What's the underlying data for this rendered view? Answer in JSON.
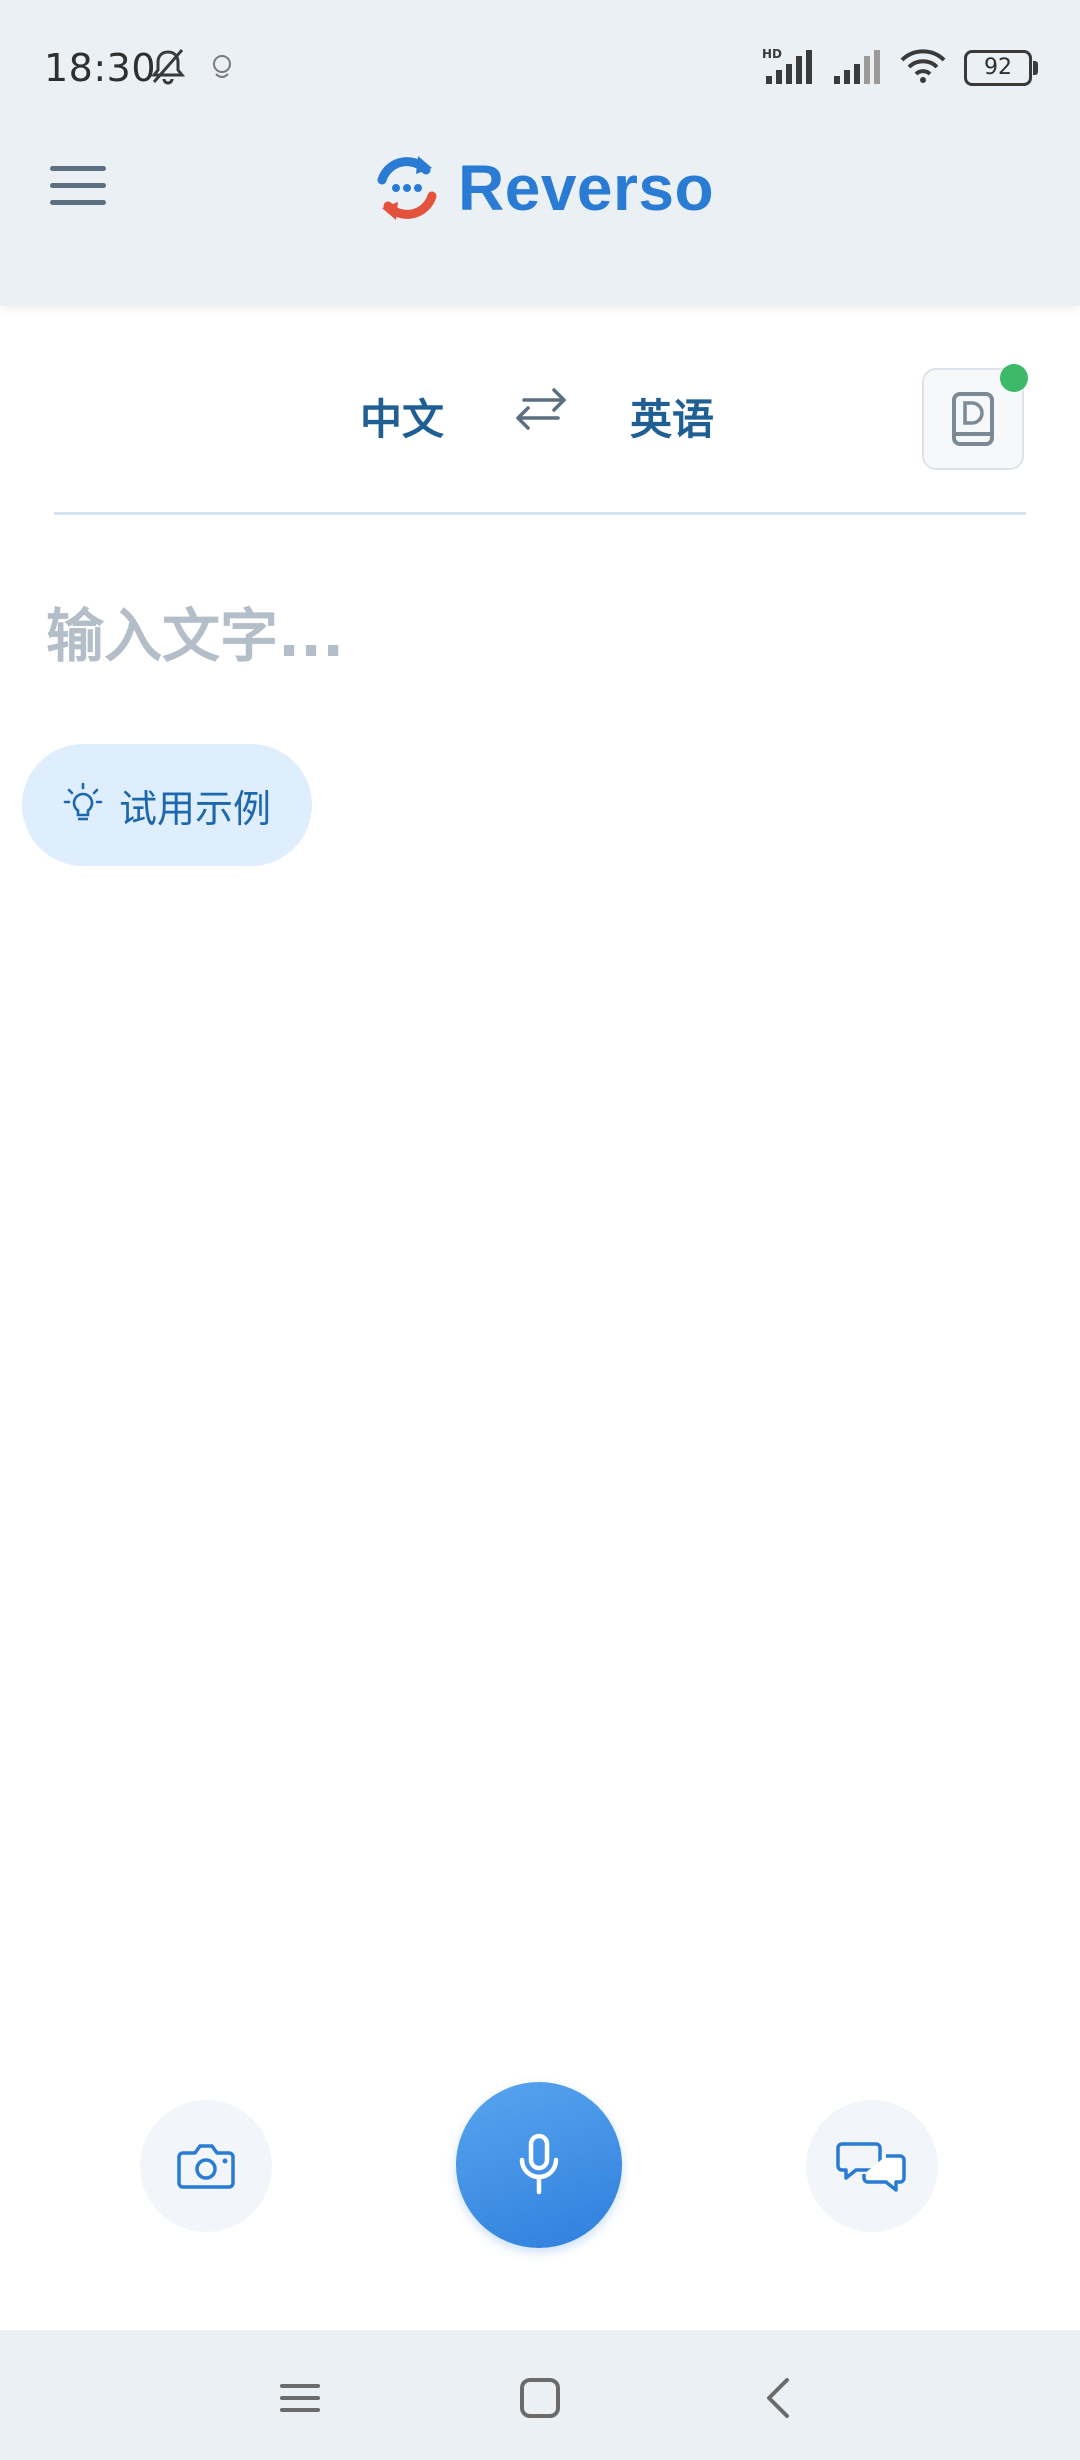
{
  "status_bar": {
    "time": "18:30",
    "battery": "92",
    "network_badge": "HD"
  },
  "header": {
    "app_name": "Reverso",
    "menu_icon": "hamburger-menu-icon"
  },
  "language": {
    "source": "中文",
    "target": "英语",
    "swap_icon": "swap-arrows-icon",
    "dictionary_icon": "dictionary-book-icon",
    "dictionary_badge_color": "#3cba6a"
  },
  "input": {
    "placeholder": "输入文字...",
    "value": ""
  },
  "example_button": {
    "label": "试用示例",
    "icon": "lightbulb-icon"
  },
  "actions": {
    "camera_icon": "camera-icon",
    "mic_icon": "microphone-icon",
    "conversation_icon": "conversation-icon"
  },
  "nav": {
    "menu_icon": "nav-menu-icon",
    "home_icon": "nav-home-icon",
    "back_icon": "nav-back-icon"
  },
  "colors": {
    "brand_blue": "#2a7bd4",
    "brand_red": "#e4513d",
    "language_text": "#1f5f94",
    "header_bg": "#ebf0f5",
    "example_bg": "#dfeefd"
  }
}
